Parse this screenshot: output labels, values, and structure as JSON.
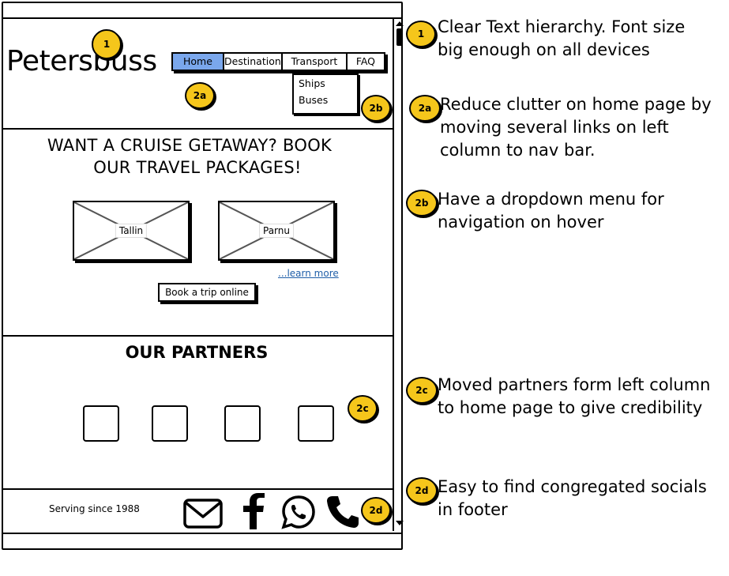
{
  "site": {
    "logo": "Petersbuss",
    "nav": [
      {
        "label": "Home",
        "active": true
      },
      {
        "label": "Destination",
        "active": false
      },
      {
        "label": "Transport",
        "active": false
      },
      {
        "label": "FAQ",
        "active": false
      }
    ],
    "dropdown": [
      "Ships",
      "Buses"
    ],
    "headline_line1": "WANT A CRUISE GETAWAY? BOOK",
    "headline_line2": "OUR TRAVEL PACKAGES!",
    "destinations": [
      "Tallin",
      "Parnu"
    ],
    "learn_more": "...learn more",
    "book_button": "Book a trip online",
    "partners_title": "OUR PARTNERS",
    "footer_text": "Serving since 1988",
    "socials": [
      "email-icon",
      "facebook-icon",
      "whatsapp-icon",
      "phone-icon"
    ]
  },
  "badges": {
    "b1": "1",
    "b2a": "2a",
    "b2b": "2b",
    "b2c": "2c",
    "b2d": "2d"
  },
  "annotations": [
    {
      "badge": "1",
      "line1": "Clear Text hierarchy. Font size",
      "line2": "big enough on all devices",
      "line3": ""
    },
    {
      "badge": "2a",
      "line1": "Reduce clutter on home page by",
      "line2": "moving several links on left",
      "line3": "column to nav bar."
    },
    {
      "badge": "2b",
      "line1": "Have a dropdown menu for",
      "line2": "navigation on hover",
      "line3": ""
    },
    {
      "badge": "2c",
      "line1": "Moved partners form left column",
      "line2": "to home page to give credibility",
      "line3": ""
    },
    {
      "badge": "2d",
      "line1": "Easy to find congregated socials",
      "line2": "in footer",
      "line3": ""
    }
  ],
  "colors": {
    "badge": "#f5c61b",
    "nav_active": "#7aa7ec",
    "link": "#1f5ea8"
  }
}
